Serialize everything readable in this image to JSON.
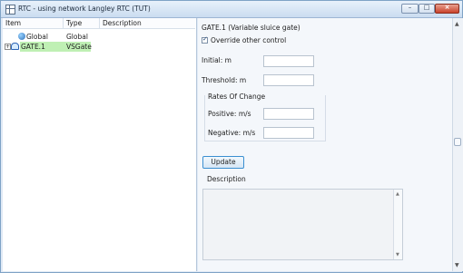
{
  "window": {
    "title": "RTC - using network Langley RTC (TUT)",
    "buttons": {
      "minimize": "–",
      "maximize": "□",
      "close": "×"
    }
  },
  "tree": {
    "columns": [
      "Item",
      "Type",
      "Description"
    ],
    "rows": [
      {
        "item": "Global",
        "type": "Global",
        "description": "",
        "icon": "globe-icon",
        "expanded": null
      },
      {
        "item": "GATE.1",
        "type": "VSGate",
        "description": "",
        "icon": "gate-icon",
        "expandable": true,
        "expand_glyph": "+",
        "selected": true
      }
    ]
  },
  "details": {
    "heading": "GATE.1 (Variable sluice gate)",
    "override_label": "Override other control",
    "override_checked": true,
    "initial_label": "Initial: m",
    "initial_value": "",
    "threshold_label": "Threshold: m",
    "threshold_value": "",
    "rates_title": "Rates Of Change",
    "positive_label": "Positive: m/s",
    "positive_value": "",
    "negative_label": "Negative: m/s",
    "negative_value": "",
    "update_label": "Update",
    "description_label": "Description",
    "description_value": ""
  },
  "scroll": {
    "up": "▲",
    "down": "▼",
    "grip": "≡"
  },
  "colors": {
    "titlebar": "#cadcf0",
    "selection_green": "#bff0b4",
    "button_border": "#3b8fd1",
    "close_red": "#c9422b"
  }
}
